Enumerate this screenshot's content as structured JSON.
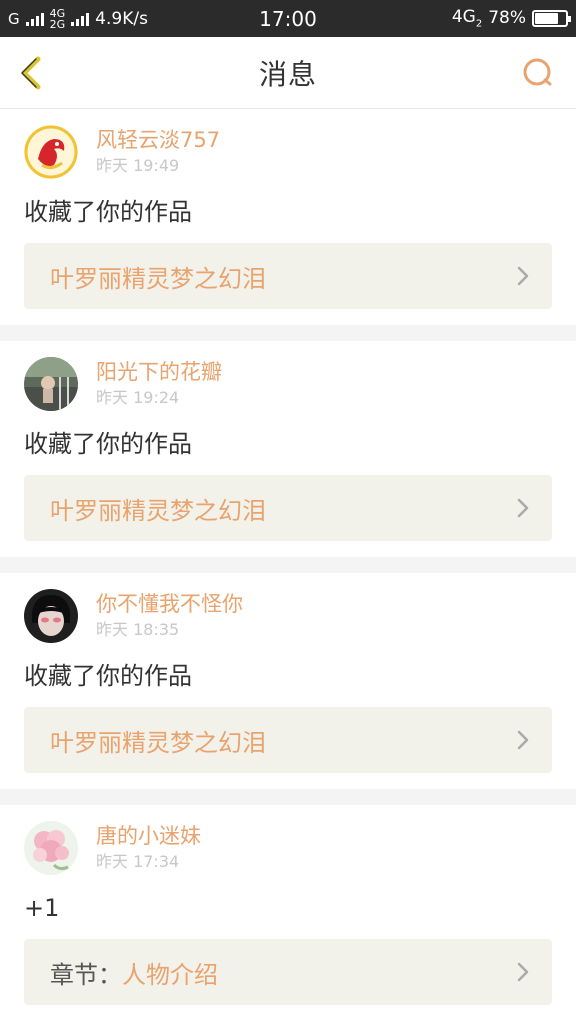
{
  "status_bar": {
    "carrier": "G",
    "net_top": "4G",
    "net_bottom": "2G",
    "speed": "4.9K/s",
    "time": "17:00",
    "net_right": "4G",
    "net_right_sub": "2",
    "battery": "78%"
  },
  "header": {
    "title": "消息",
    "back_icon": "chevron-left-icon",
    "search_icon": "search-icon",
    "accent": "#e8a36e"
  },
  "messages": [
    {
      "user": "风轻云淡757",
      "time": "昨天 19:49",
      "text": "收藏了你的作品",
      "work": "叶罗丽精灵梦之幻泪",
      "work_prefix": ""
    },
    {
      "user": "阳光下的花瓣",
      "time": "昨天 19:24",
      "text": "收藏了你的作品",
      "work": "叶罗丽精灵梦之幻泪",
      "work_prefix": ""
    },
    {
      "user": "你不懂我不怪你",
      "time": "昨天 18:35",
      "text": "收藏了你的作品",
      "work": "叶罗丽精灵梦之幻泪",
      "work_prefix": ""
    },
    {
      "user": "唐的小迷妹",
      "time": "昨天 17:34",
      "text": "+1",
      "work": "人物介绍",
      "work_prefix": "章节："
    }
  ]
}
